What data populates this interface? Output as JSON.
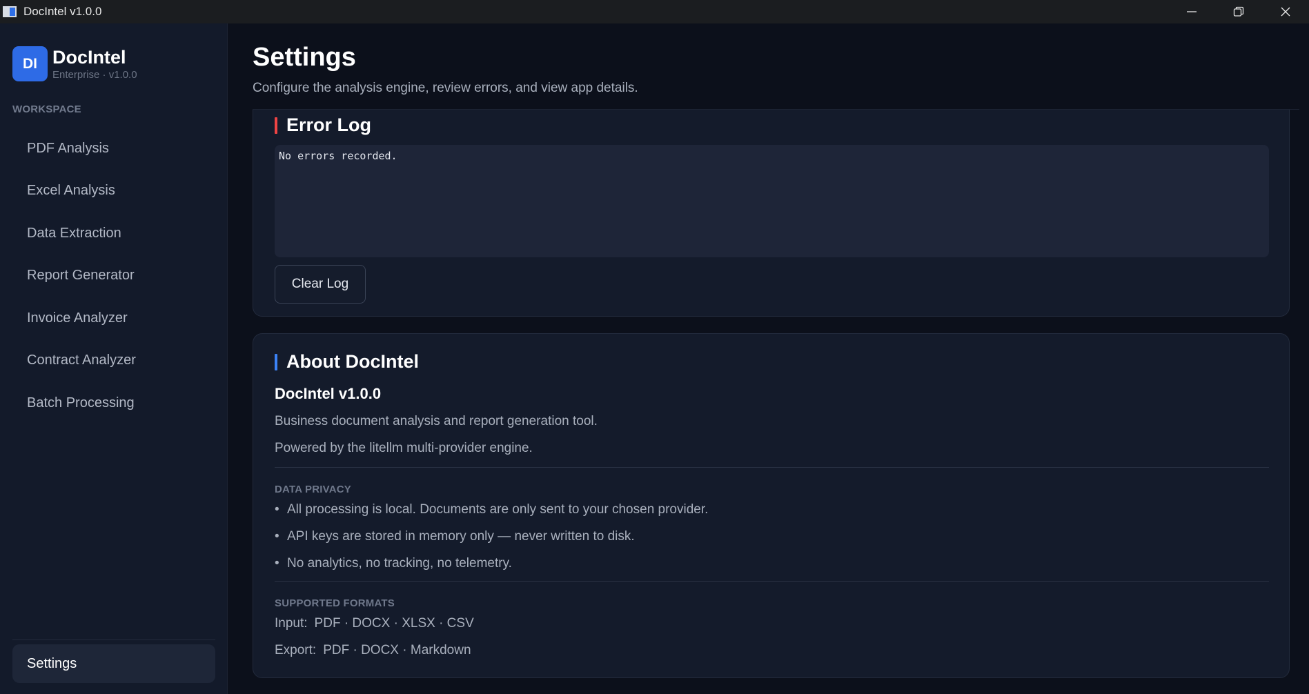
{
  "window": {
    "title": "DocIntel v1.0.0",
    "controls": [
      "minimize-icon",
      "restore-icon",
      "close-icon"
    ]
  },
  "sidebar": {
    "logo_text": "DI",
    "brand_name": "DocIntel",
    "brand_sub": "Enterprise · v1.0.0",
    "section_label": "WORKSPACE",
    "items": [
      {
        "label": "PDF Analysis"
      },
      {
        "label": "Excel Analysis"
      },
      {
        "label": "Data Extraction"
      },
      {
        "label": "Report Generator"
      },
      {
        "label": "Invoice Analyzer"
      },
      {
        "label": "Contract Analyzer"
      },
      {
        "label": "Batch Processing"
      }
    ],
    "settings_label": "Settings"
  },
  "header": {
    "title": "Settings",
    "subtitle": "Configure the analysis engine, review errors, and view app details."
  },
  "error_log": {
    "heading": "Error Log",
    "content": "No errors recorded.",
    "clear_button": "Clear Log"
  },
  "about": {
    "heading": "About DocIntel",
    "version": "DocIntel v1.0.0",
    "description": "Business document analysis and report generation tool.",
    "powered_by": "Powered by the litellm multi-provider engine.",
    "privacy_label": "DATA PRIVACY",
    "privacy_items": [
      "All processing is local. Documents are only sent to your chosen provider.",
      "API keys are stored in memory only — never written to disk.",
      "No analytics, no tracking, no telemetry."
    ],
    "formats_label": "SUPPORTED FORMATS",
    "input_label": "Input:",
    "input_formats": "PDF · DOCX · XLSX · CSV",
    "export_label": "Export:",
    "export_formats": "PDF · DOCX · Markdown"
  },
  "colors": {
    "accent_blue": "#2e6be6",
    "accent_red": "#ef4444",
    "background": "#0c101b",
    "sidebar": "#131a2a"
  }
}
